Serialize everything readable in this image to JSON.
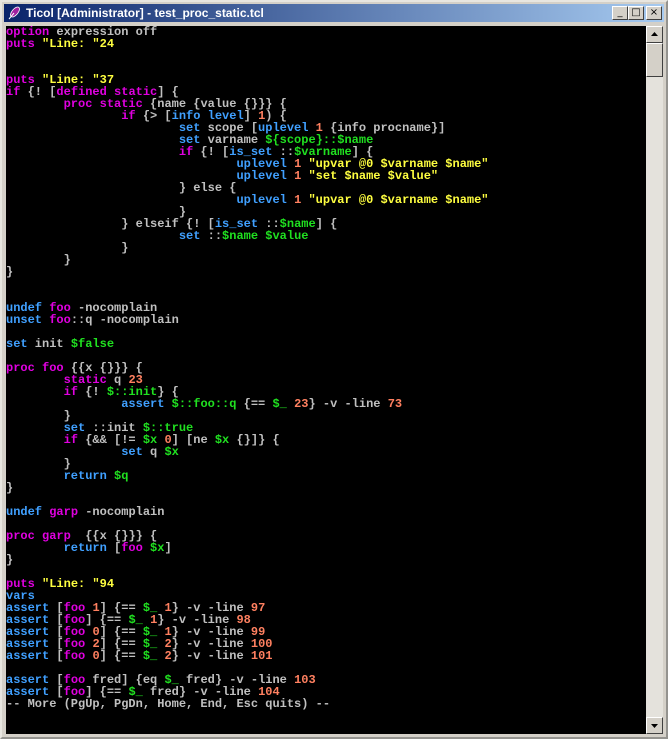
{
  "window": {
    "title": "Ticol [Administrator] - test_proc_static.tcl",
    "icon": "feather-pen-icon",
    "buttons": {
      "minimize": "_",
      "maximize": "□",
      "close": "×"
    }
  },
  "colors": {
    "keyword": "#e000e0",
    "string": "#ffff40",
    "variable": "#20e020",
    "number": "#ff8060",
    "command": "#40a0ff",
    "plain": "#c0c0c0"
  },
  "console": {
    "lines": [
      [
        [
          "kw",
          "option"
        ],
        [
          "pl",
          " expression off"
        ]
      ],
      [
        [
          "kw",
          "puts"
        ],
        [
          "pl",
          " "
        ],
        [
          "str",
          "\"Line: \"24"
        ]
      ],
      [],
      [],
      [
        [
          "kw",
          "puts"
        ],
        [
          "pl",
          " "
        ],
        [
          "str",
          "\"Line: \"37"
        ]
      ],
      [
        [
          "kw",
          "if"
        ],
        [
          "pl",
          " {! ["
        ],
        [
          "kw",
          "defined"
        ],
        [
          "pl",
          " "
        ],
        [
          "kw",
          "static"
        ],
        [
          "pl",
          "] {"
        ]
      ],
      [
        [
          "pl",
          "        "
        ],
        [
          "kw",
          "proc"
        ],
        [
          "pl",
          " "
        ],
        [
          "kw",
          "static"
        ],
        [
          "pl",
          " {name {value {}}} {"
        ]
      ],
      [
        [
          "pl",
          "                "
        ],
        [
          "kw",
          "if"
        ],
        [
          "pl",
          " {> ["
        ],
        [
          "cmd",
          "info level"
        ],
        [
          "pl",
          "] "
        ],
        [
          "num",
          "1"
        ],
        [
          "pl",
          ") {"
        ]
      ],
      [
        [
          "pl",
          "                        "
        ],
        [
          "cmd",
          "set"
        ],
        [
          "pl",
          " scope ["
        ],
        [
          "cmd",
          "uplevel"
        ],
        [
          "pl",
          " "
        ],
        [
          "num",
          "1"
        ],
        [
          "pl",
          " {info procname}]"
        ]
      ],
      [
        [
          "pl",
          "                        "
        ],
        [
          "cmd",
          "set"
        ],
        [
          "pl",
          " varname "
        ],
        [
          "var",
          "${scope}::$name"
        ]
      ],
      [
        [
          "pl",
          "                        "
        ],
        [
          "kw",
          "if"
        ],
        [
          "pl",
          " {! ["
        ],
        [
          "cmd",
          "is_set"
        ],
        [
          "pl",
          " ::"
        ],
        [
          "var",
          "$varname"
        ],
        [
          "pl",
          "] {"
        ]
      ],
      [
        [
          "pl",
          "                                "
        ],
        [
          "cmd",
          "uplevel"
        ],
        [
          "pl",
          " "
        ],
        [
          "num",
          "1"
        ],
        [
          "pl",
          " "
        ],
        [
          "str",
          "\"upvar @0 $varname $name\""
        ]
      ],
      [
        [
          "pl",
          "                                "
        ],
        [
          "cmd",
          "uplevel"
        ],
        [
          "pl",
          " "
        ],
        [
          "num",
          "1"
        ],
        [
          "pl",
          " "
        ],
        [
          "str",
          "\"set $name $value\""
        ]
      ],
      [
        [
          "pl",
          "                        } else {"
        ]
      ],
      [
        [
          "pl",
          "                                "
        ],
        [
          "cmd",
          "uplevel"
        ],
        [
          "pl",
          " "
        ],
        [
          "num",
          "1"
        ],
        [
          "pl",
          " "
        ],
        [
          "str",
          "\"upvar @0 $varname $name\""
        ]
      ],
      [
        [
          "pl",
          "                        }"
        ]
      ],
      [
        [
          "pl",
          "                } elseif {! ["
        ],
        [
          "cmd",
          "is_set"
        ],
        [
          "pl",
          " ::"
        ],
        [
          "var",
          "$name"
        ],
        [
          "pl",
          "] {"
        ]
      ],
      [
        [
          "pl",
          "                        "
        ],
        [
          "cmd",
          "set"
        ],
        [
          "pl",
          " ::"
        ],
        [
          "var",
          "$name"
        ],
        [
          "pl",
          " "
        ],
        [
          "var",
          "$value"
        ]
      ],
      [
        [
          "pl",
          "                }"
        ]
      ],
      [
        [
          "pl",
          "        }"
        ]
      ],
      [
        [
          "pl",
          "}"
        ]
      ],
      [],
      [],
      [
        [
          "cmd",
          "undef"
        ],
        [
          "pl",
          " "
        ],
        [
          "kw",
          "foo"
        ],
        [
          "pl",
          " -nocomplain"
        ]
      ],
      [
        [
          "cmd",
          "unset"
        ],
        [
          "pl",
          " "
        ],
        [
          "kw",
          "foo"
        ],
        [
          "pl",
          "::q -nocomplain"
        ]
      ],
      [],
      [
        [
          "cmd",
          "set"
        ],
        [
          "pl",
          " init "
        ],
        [
          "var",
          "$false"
        ]
      ],
      [],
      [
        [
          "kw",
          "proc"
        ],
        [
          "pl",
          " "
        ],
        [
          "kw",
          "foo"
        ],
        [
          "pl",
          " {{x {}}} {"
        ]
      ],
      [
        [
          "pl",
          "        "
        ],
        [
          "kw",
          "static"
        ],
        [
          "pl",
          " q "
        ],
        [
          "num",
          "23"
        ]
      ],
      [
        [
          "pl",
          "        "
        ],
        [
          "kw",
          "if"
        ],
        [
          "pl",
          " {! "
        ],
        [
          "var",
          "$::init"
        ],
        [
          "pl",
          "} {"
        ]
      ],
      [
        [
          "pl",
          "                "
        ],
        [
          "cmd",
          "assert"
        ],
        [
          "pl",
          " "
        ],
        [
          "var",
          "$::foo::q"
        ],
        [
          "pl",
          " {== "
        ],
        [
          "var",
          "$_"
        ],
        [
          "pl",
          " "
        ],
        [
          "num",
          "23"
        ],
        [
          "pl",
          "} -v -line "
        ],
        [
          "num",
          "73"
        ]
      ],
      [
        [
          "pl",
          "        }"
        ]
      ],
      [
        [
          "pl",
          "        "
        ],
        [
          "cmd",
          "set"
        ],
        [
          "pl",
          " ::init "
        ],
        [
          "var",
          "$::true"
        ]
      ],
      [
        [
          "pl",
          "        "
        ],
        [
          "kw",
          "if"
        ],
        [
          "pl",
          " {&& [!= "
        ],
        [
          "var",
          "$x"
        ],
        [
          "pl",
          " "
        ],
        [
          "num",
          "0"
        ],
        [
          "pl",
          "] [ne "
        ],
        [
          "var",
          "$x"
        ],
        [
          "pl",
          " {}]} {"
        ]
      ],
      [
        [
          "pl",
          "                "
        ],
        [
          "cmd",
          "set"
        ],
        [
          "pl",
          " q "
        ],
        [
          "var",
          "$x"
        ]
      ],
      [
        [
          "pl",
          "        }"
        ]
      ],
      [
        [
          "pl",
          "        "
        ],
        [
          "cmd",
          "return"
        ],
        [
          "pl",
          " "
        ],
        [
          "var",
          "$q"
        ]
      ],
      [
        [
          "pl",
          "}"
        ]
      ],
      [],
      [
        [
          "cmd",
          "undef"
        ],
        [
          "pl",
          " "
        ],
        [
          "kw",
          "garp"
        ],
        [
          "pl",
          " -nocomplain"
        ]
      ],
      [],
      [
        [
          "kw",
          "proc"
        ],
        [
          "pl",
          " "
        ],
        [
          "kw",
          "garp"
        ],
        [
          "pl",
          "  {{x {}}} {"
        ]
      ],
      [
        [
          "pl",
          "        "
        ],
        [
          "cmd",
          "return"
        ],
        [
          "pl",
          " ["
        ],
        [
          "kw",
          "foo"
        ],
        [
          "pl",
          " "
        ],
        [
          "var",
          "$x"
        ],
        [
          "pl",
          "]"
        ]
      ],
      [
        [
          "pl",
          "}"
        ]
      ],
      [],
      [
        [
          "kw",
          "puts"
        ],
        [
          "pl",
          " "
        ],
        [
          "str",
          "\"Line: \"94"
        ]
      ],
      [
        [
          "cmd",
          "vars"
        ]
      ],
      [
        [
          "cmd",
          "assert"
        ],
        [
          "pl",
          " ["
        ],
        [
          "kw",
          "foo"
        ],
        [
          "pl",
          " "
        ],
        [
          "num",
          "1"
        ],
        [
          "pl",
          "] {== "
        ],
        [
          "var",
          "$_"
        ],
        [
          "pl",
          " "
        ],
        [
          "num",
          "1"
        ],
        [
          "pl",
          "} -v -line "
        ],
        [
          "num",
          "97"
        ]
      ],
      [
        [
          "cmd",
          "assert"
        ],
        [
          "pl",
          " ["
        ],
        [
          "kw",
          "foo"
        ],
        [
          "pl",
          "] {== "
        ],
        [
          "var",
          "$_"
        ],
        [
          "pl",
          " "
        ],
        [
          "num",
          "1"
        ],
        [
          "pl",
          "} -v -line "
        ],
        [
          "num",
          "98"
        ]
      ],
      [
        [
          "cmd",
          "assert"
        ],
        [
          "pl",
          " ["
        ],
        [
          "kw",
          "foo"
        ],
        [
          "pl",
          " "
        ],
        [
          "num",
          "0"
        ],
        [
          "pl",
          "] {== "
        ],
        [
          "var",
          "$_"
        ],
        [
          "pl",
          " "
        ],
        [
          "num",
          "1"
        ],
        [
          "pl",
          "} -v -line "
        ],
        [
          "num",
          "99"
        ]
      ],
      [
        [
          "cmd",
          "assert"
        ],
        [
          "pl",
          " ["
        ],
        [
          "kw",
          "foo"
        ],
        [
          "pl",
          " "
        ],
        [
          "num",
          "2"
        ],
        [
          "pl",
          "] {== "
        ],
        [
          "var",
          "$_"
        ],
        [
          "pl",
          " "
        ],
        [
          "num",
          "2"
        ],
        [
          "pl",
          "} -v -line "
        ],
        [
          "num",
          "100"
        ]
      ],
      [
        [
          "cmd",
          "assert"
        ],
        [
          "pl",
          " ["
        ],
        [
          "kw",
          "foo"
        ],
        [
          "pl",
          " "
        ],
        [
          "num",
          "0"
        ],
        [
          "pl",
          "] {== "
        ],
        [
          "var",
          "$_"
        ],
        [
          "pl",
          " "
        ],
        [
          "num",
          "2"
        ],
        [
          "pl",
          "} -v -line "
        ],
        [
          "num",
          "101"
        ]
      ],
      [],
      [
        [
          "cmd",
          "assert"
        ],
        [
          "pl",
          " ["
        ],
        [
          "kw",
          "foo"
        ],
        [
          "pl",
          " fred] {eq "
        ],
        [
          "var",
          "$_"
        ],
        [
          "pl",
          " fred} -v -line "
        ],
        [
          "num",
          "103"
        ]
      ],
      [
        [
          "cmd",
          "assert"
        ],
        [
          "pl",
          " ["
        ],
        [
          "kw",
          "foo"
        ],
        [
          "pl",
          "] {== "
        ],
        [
          "var",
          "$_"
        ],
        [
          "pl",
          " fred} -v -line "
        ],
        [
          "num",
          "104"
        ]
      ],
      [
        [
          "pl",
          "-- More (PgUp, PgDn, Home, End, Esc quits) --"
        ]
      ]
    ]
  },
  "scrollbar": {
    "up_icon": "arrow-up-icon",
    "down_icon": "arrow-down-icon",
    "up_glyph": "▲",
    "down_glyph": "▼"
  }
}
